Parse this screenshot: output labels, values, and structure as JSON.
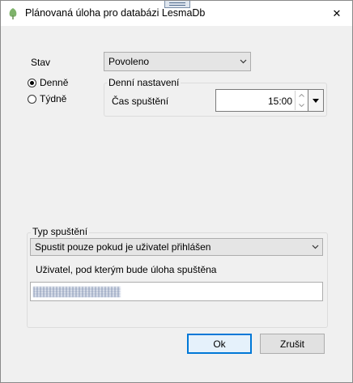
{
  "window": {
    "title": "Plánovaná úloha pro databázi LesmaDb",
    "close_glyph": "✕",
    "icon": "app-leaf-icon"
  },
  "status": {
    "label": "Stav",
    "selected": "Povoleno"
  },
  "frequency": {
    "options": [
      {
        "label": "Denně",
        "checked": true
      },
      {
        "label": "Týdně",
        "checked": false
      }
    ]
  },
  "daily_settings": {
    "title": "Denní nastavení",
    "time_label": "Čas spuštění",
    "time_value": "15:00"
  },
  "run_type": {
    "title": "Typ spuštění",
    "selected": "Spustit pouze pokud je uživatel přihlášen",
    "user_label": "Uživatel, pod kterým bude úloha spuštěna"
  },
  "buttons": {
    "ok": "Ok",
    "cancel": "Zrušit"
  },
  "colors": {
    "accent": "#0078d7",
    "window_bg": "#f0f0f0"
  }
}
